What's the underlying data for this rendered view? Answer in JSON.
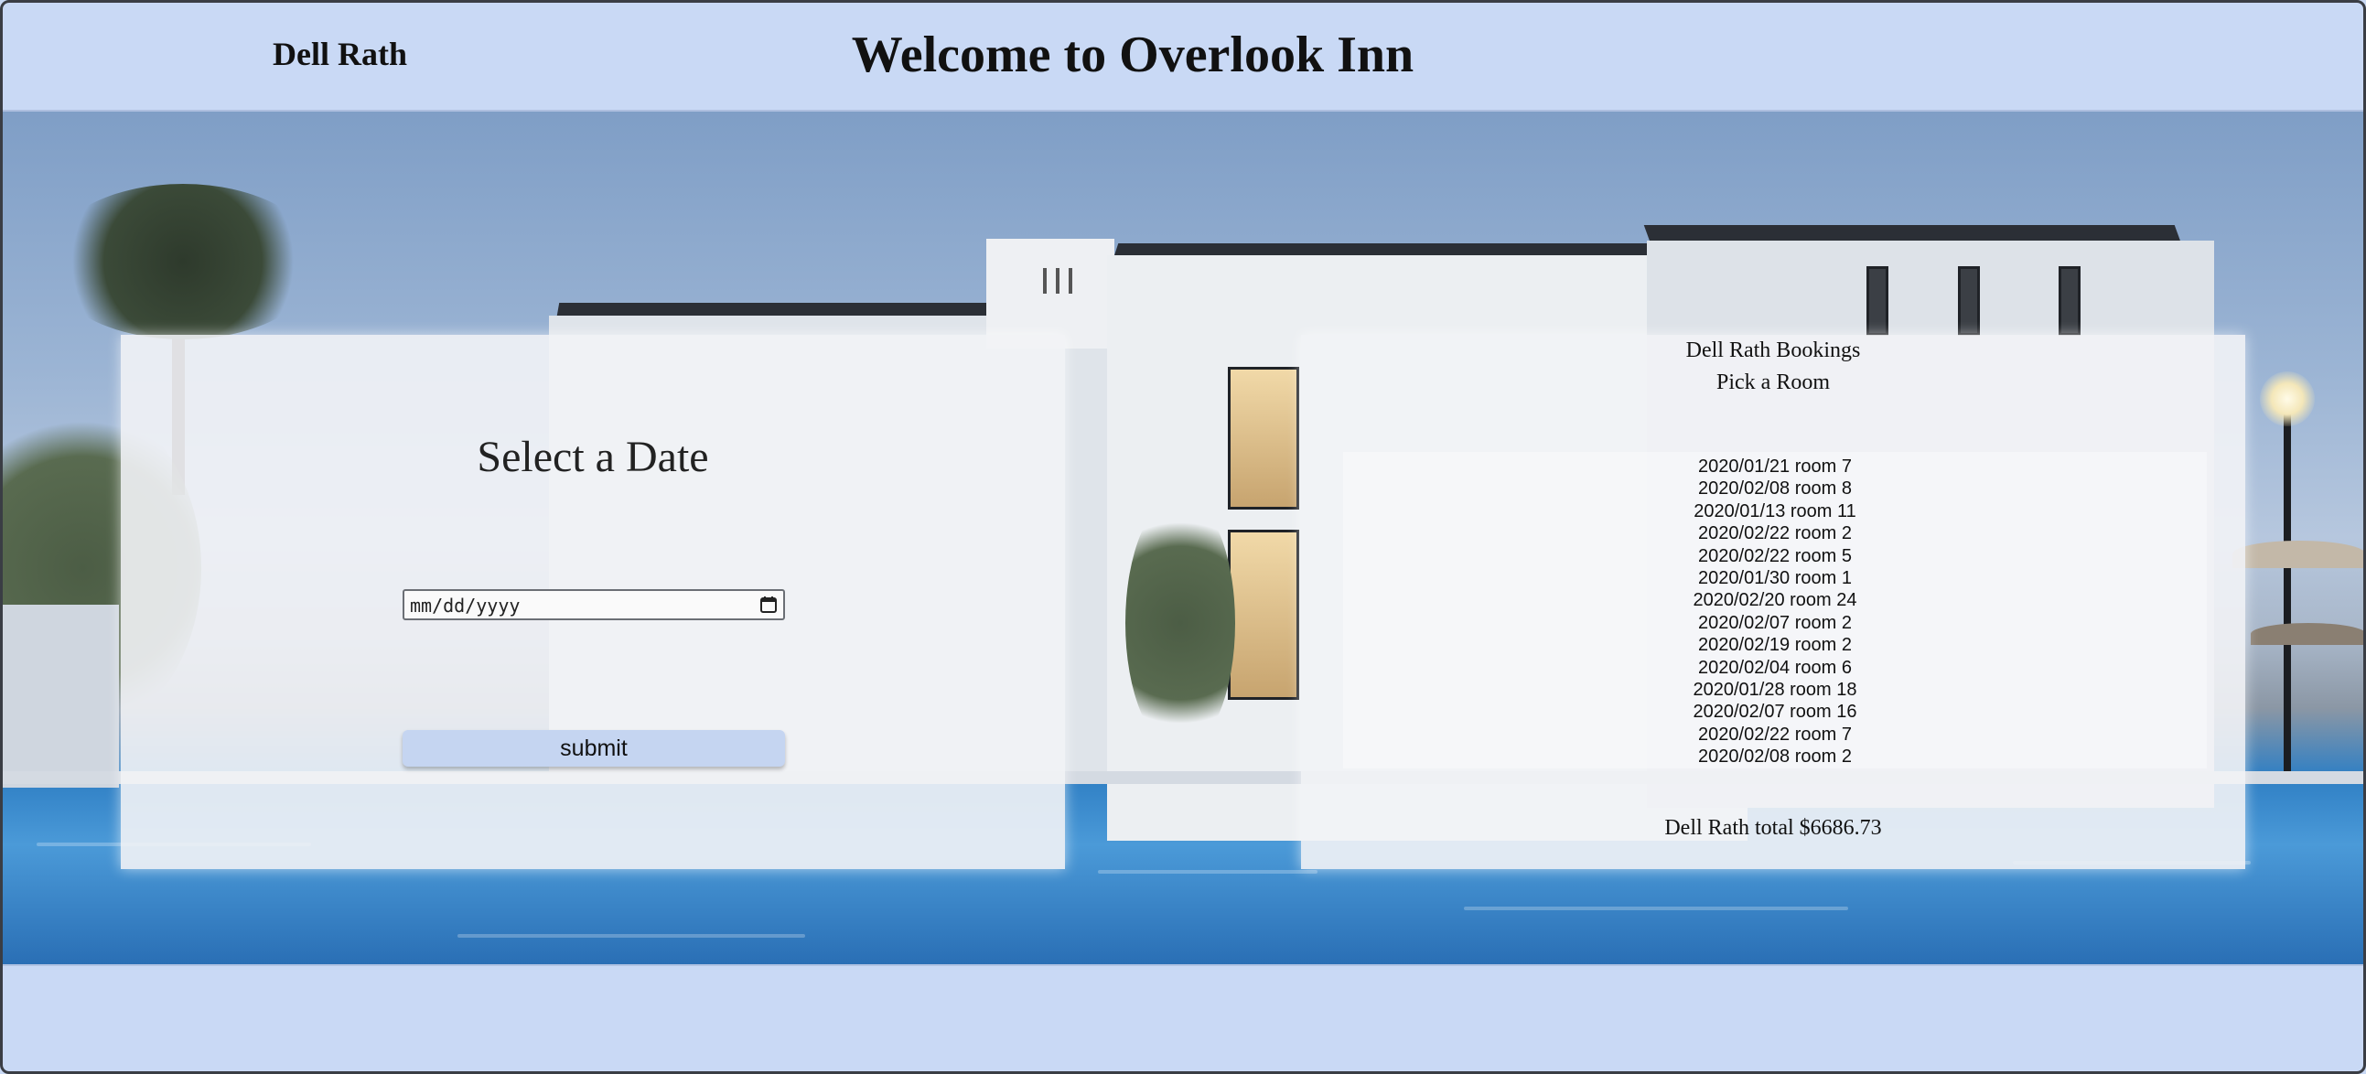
{
  "header": {
    "user_name": "Dell Rath",
    "title": "Welcome to Overlook Inn"
  },
  "date_panel": {
    "title": "Select a Date",
    "date_input_placeholder": "mm/dd/yyyy",
    "submit_label": "submit"
  },
  "bookings_panel": {
    "title": "Dell Rath Bookings",
    "subtitle": "Pick a Room",
    "bookings": [
      "2020/01/21 room 7",
      "2020/02/08 room 8",
      "2020/01/13 room 11",
      "2020/02/22 room 2",
      "2020/02/22 room 5",
      "2020/01/30 room 1",
      "2020/02/20 room 24",
      "2020/02/07 room 2",
      "2020/02/19 room 2",
      "2020/02/04 room 6",
      "2020/01/28 room 18",
      "2020/02/07 room 16",
      "2020/02/22 room 7",
      "2020/02/08 room 2"
    ],
    "total_text": "Dell Rath total $6686.73"
  },
  "colors": {
    "header_bg": "#c9d9f5",
    "button_bg": "#c5d5f1",
    "panel_bg": "#f2f3f6"
  }
}
